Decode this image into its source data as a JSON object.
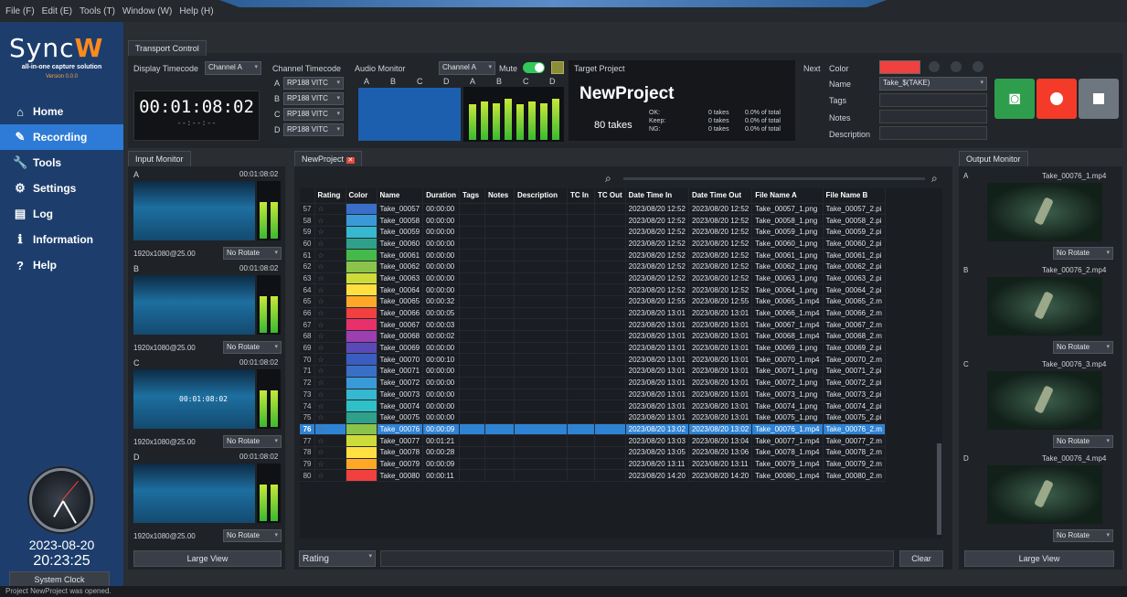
{
  "menu": [
    "File (F)",
    "Edit (E)",
    "Tools (T)",
    "Window (W)",
    "Help (H)"
  ],
  "app": {
    "logo_a": "Sync",
    "logo_b": "W",
    "tagline": "all-in-one capture solution",
    "version": "Version 0.0.0"
  },
  "nav": [
    {
      "label": "Home",
      "icon": "home-icon",
      "glyph": "⌂"
    },
    {
      "label": "Recording",
      "icon": "pencil-icon",
      "glyph": "✎"
    },
    {
      "label": "Tools",
      "icon": "wrench-icon",
      "glyph": "🔧"
    },
    {
      "label": "Settings",
      "icon": "gear-icon",
      "glyph": "⚙"
    },
    {
      "label": "Log",
      "icon": "document-icon",
      "glyph": "▤"
    },
    {
      "label": "Information",
      "icon": "info-icon",
      "glyph": "ℹ"
    },
    {
      "label": "Help",
      "icon": "question-icon",
      "glyph": "?"
    }
  ],
  "nav_active": 1,
  "clock": {
    "date": "2023-08-20",
    "time": "20:23:25",
    "button": "System Clock"
  },
  "transport": {
    "tab": "Transport Control",
    "display_timecode_label": "Display Timecode",
    "display_channel": "Channel A",
    "timecode": "00:01:08:02",
    "timecode_sub": "--:--:--",
    "channel_timecode_label": "Channel Timecode",
    "channels": [
      {
        "ch": "A",
        "src": "RP188 VITC"
      },
      {
        "ch": "B",
        "src": "RP188 VITC"
      },
      {
        "ch": "C",
        "src": "RP188 VITC"
      },
      {
        "ch": "D",
        "src": "RP188 VITC"
      }
    ],
    "audio_monitor_label": "Audio Monitor",
    "audio_channel": "Channel A",
    "mute_label": "Mute",
    "audio_letters": [
      "A",
      "B",
      "C",
      "D",
      "A",
      "B",
      "C",
      "D"
    ],
    "meter_levels": [
      0.7,
      0.75,
      0.72,
      0.8
    ]
  },
  "target": {
    "label": "Target Project",
    "name": "NewProject",
    "takes": "80 takes",
    "stats": [
      {
        "k": "OK:",
        "v": "0 takes",
        "p": "0.0% of total"
      },
      {
        "k": "Keep:",
        "v": "0 takes",
        "p": "0.0% of total"
      },
      {
        "k": "NG:",
        "v": "0 takes",
        "p": "0.0% of total"
      }
    ]
  },
  "next": {
    "label": "Next",
    "color_label": "Color",
    "color": "#f04040",
    "name_label": "Name",
    "name_value": "Take_$(TAKE)",
    "tags_label": "Tags",
    "notes_label": "Notes",
    "desc_label": "Description"
  },
  "input_monitor": {
    "tab": "Input Monitor",
    "cams": [
      {
        "id": "A",
        "tc": "00:01:08:02",
        "fmt": "1920x1080@25.00",
        "rot": "No Rotate"
      },
      {
        "id": "B",
        "tc": "00:01:08:02",
        "fmt": "1920x1080@25.00",
        "rot": "No Rotate"
      },
      {
        "id": "C",
        "tc": "00:01:08:02",
        "fmt": "1920x1080@25.00",
        "rot": "No Rotate"
      },
      {
        "id": "D",
        "tc": "00:01:08:02",
        "fmt": "1920x1080@25.00",
        "rot": "No Rotate"
      }
    ],
    "overlay_tc": "00:01:08:02",
    "large_view": "Large View"
  },
  "project_tab": "NewProject",
  "columns": [
    "",
    "Rating",
    "Color",
    "Name",
    "Duration",
    "Tags",
    "Notes",
    "Description",
    "TC In",
    "TC Out",
    "Date Time In",
    "Date Time Out",
    "File Name A",
    "File Name B"
  ],
  "rows": [
    {
      "n": "57",
      "color": "#3a6fc8",
      "name": "Take_00057",
      "dur": "00:00:00",
      "din": "2023/08/20 12:52",
      "dout": "2023/08/20 12:52",
      "fa": "Take_00057_1.png",
      "fb": "Take_00057_2.pi"
    },
    {
      "n": "58",
      "color": "#3a9ad8",
      "name": "Take_00058",
      "dur": "00:00:00",
      "din": "2023/08/20 12:52",
      "dout": "2023/08/20 12:52",
      "fa": "Take_00058_1.png",
      "fb": "Take_00058_2.pi"
    },
    {
      "n": "59",
      "color": "#35b8d0",
      "name": "Take_00059",
      "dur": "00:00:00",
      "din": "2023/08/20 12:52",
      "dout": "2023/08/20 12:52",
      "fa": "Take_00059_1.png",
      "fb": "Take_00059_2.pi"
    },
    {
      "n": "60",
      "color": "#2fa08a",
      "name": "Take_00060",
      "dur": "00:00:00",
      "din": "2023/08/20 12:52",
      "dout": "2023/08/20 12:52",
      "fa": "Take_00060_1.png",
      "fb": "Take_00060_2.pi"
    },
    {
      "n": "61",
      "color": "#45b84a",
      "name": "Take_00061",
      "dur": "00:00:00",
      "din": "2023/08/20 12:52",
      "dout": "2023/08/20 12:52",
      "fa": "Take_00061_1.png",
      "fb": "Take_00061_2.pi"
    },
    {
      "n": "62",
      "color": "#8cc34a",
      "name": "Take_00062",
      "dur": "00:00:00",
      "din": "2023/08/20 12:52",
      "dout": "2023/08/20 12:52",
      "fa": "Take_00062_1.png",
      "fb": "Take_00062_2.pi"
    },
    {
      "n": "63",
      "color": "#cddc39",
      "name": "Take_00063",
      "dur": "00:00:00",
      "din": "2023/08/20 12:52",
      "dout": "2023/08/20 12:52",
      "fa": "Take_00063_1.png",
      "fb": "Take_00063_2.pi"
    },
    {
      "n": "64",
      "color": "#ffe040",
      "name": "Take_00064",
      "dur": "00:00:00",
      "din": "2023/08/20 12:52",
      "dout": "2023/08/20 12:52",
      "fa": "Take_00064_1.png",
      "fb": "Take_00064_2.pi"
    },
    {
      "n": "65",
      "color": "#ffa726",
      "name": "Take_00065",
      "dur": "00:00:32",
      "din": "2023/08/20 12:55",
      "dout": "2023/08/20 12:55",
      "fa": "Take_00065_1.mp4",
      "fb": "Take_00065_2.m"
    },
    {
      "n": "66",
      "color": "#f04040",
      "name": "Take_00066",
      "dur": "00:00:05",
      "din": "2023/08/20 13:01",
      "dout": "2023/08/20 13:01",
      "fa": "Take_00066_1.mp4",
      "fb": "Take_00066_2.m"
    },
    {
      "n": "67",
      "color": "#e8306a",
      "name": "Take_00067",
      "dur": "00:00:03",
      "din": "2023/08/20 13:01",
      "dout": "2023/08/20 13:01",
      "fa": "Take_00067_1.mp4",
      "fb": "Take_00067_2.m"
    },
    {
      "n": "68",
      "color": "#9c3fb0",
      "name": "Take_00068",
      "dur": "00:00:02",
      "din": "2023/08/20 13:01",
      "dout": "2023/08/20 13:01",
      "fa": "Take_00068_1.mp4",
      "fb": "Take_00068_2.m"
    },
    {
      "n": "69",
      "color": "#5a4ab8",
      "name": "Take_00069",
      "dur": "00:00:00",
      "din": "2023/08/20 13:01",
      "dout": "2023/08/20 13:01",
      "fa": "Take_00069_1.png",
      "fb": "Take_00069_2.pi"
    },
    {
      "n": "70",
      "color": "#3a5ec0",
      "name": "Take_00070",
      "dur": "00:00:10",
      "din": "2023/08/20 13:01",
      "dout": "2023/08/20 13:01",
      "fa": "Take_00070_1.mp4",
      "fb": "Take_00070_2.m"
    },
    {
      "n": "71",
      "color": "#3a6fc8",
      "name": "Take_00071",
      "dur": "00:00:00",
      "din": "2023/08/20 13:01",
      "dout": "2023/08/20 13:01",
      "fa": "Take_00071_1.png",
      "fb": "Take_00071_2.pi"
    },
    {
      "n": "72",
      "color": "#3a9ad8",
      "name": "Take_00072",
      "dur": "00:00:00",
      "din": "2023/08/20 13:01",
      "dout": "2023/08/20 13:01",
      "fa": "Take_00072_1.png",
      "fb": "Take_00072_2.pi"
    },
    {
      "n": "73",
      "color": "#35b8d0",
      "name": "Take_00073",
      "dur": "00:00:00",
      "din": "2023/08/20 13:01",
      "dout": "2023/08/20 13:01",
      "fa": "Take_00073_1.png",
      "fb": "Take_00073_2.pi"
    },
    {
      "n": "74",
      "color": "#2fc0c8",
      "name": "Take_00074",
      "dur": "00:00:00",
      "din": "2023/08/20 13:01",
      "dout": "2023/08/20 13:01",
      "fa": "Take_00074_1.png",
      "fb": "Take_00074_2.pi"
    },
    {
      "n": "75",
      "color": "#2fa08a",
      "name": "Take_00075",
      "dur": "00:00:00",
      "din": "2023/08/20 13:01",
      "dout": "2023/08/20 13:01",
      "fa": "Take_00075_1.png",
      "fb": "Take_00075_2.pi"
    },
    {
      "n": "76",
      "color": "#8cc34a",
      "name": "Take_00076",
      "dur": "00:00:09",
      "din": "2023/08/20 13:02",
      "dout": "2023/08/20 13:02",
      "fa": "Take_00076_1.mp4",
      "fb": "Take_00076_2.m"
    },
    {
      "n": "77",
      "color": "#cddc39",
      "name": "Take_00077",
      "dur": "00:01:21",
      "din": "2023/08/20 13:03",
      "dout": "2023/08/20 13:04",
      "fa": "Take_00077_1.mp4",
      "fb": "Take_00077_2.m"
    },
    {
      "n": "78",
      "color": "#ffe040",
      "name": "Take_00078",
      "dur": "00:00:28",
      "din": "2023/08/20 13:05",
      "dout": "2023/08/20 13:06",
      "fa": "Take_00078_1.mp4",
      "fb": "Take_00078_2.m"
    },
    {
      "n": "79",
      "color": "#ffa726",
      "name": "Take_00079",
      "dur": "00:00:09",
      "din": "2023/08/20 13:11",
      "dout": "2023/08/20 13:11",
      "fa": "Take_00079_1.mp4",
      "fb": "Take_00079_2.m"
    },
    {
      "n": "80",
      "color": "#f04040",
      "name": "Take_00080",
      "dur": "00:00:11",
      "din": "2023/08/20 14:20",
      "dout": "2023/08/20 14:20",
      "fa": "Take_00080_1.mp4",
      "fb": "Take_00080_2.m"
    }
  ],
  "selected_row": "76",
  "filter": {
    "field": "Rating",
    "clear": "Clear"
  },
  "output_monitor": {
    "tab": "Output Monitor",
    "outs": [
      {
        "id": "A",
        "file": "Take_00076_1.mp4",
        "rot": "No Rotate"
      },
      {
        "id": "B",
        "file": "Take_00076_2.mp4",
        "rot": "No Rotate"
      },
      {
        "id": "C",
        "file": "Take_00076_3.mp4",
        "rot": "No Rotate"
      },
      {
        "id": "D",
        "file": "Take_00076_4.mp4",
        "rot": "No Rotate"
      }
    ],
    "large_view": "Large View"
  },
  "status": "Project NewProject was opened."
}
